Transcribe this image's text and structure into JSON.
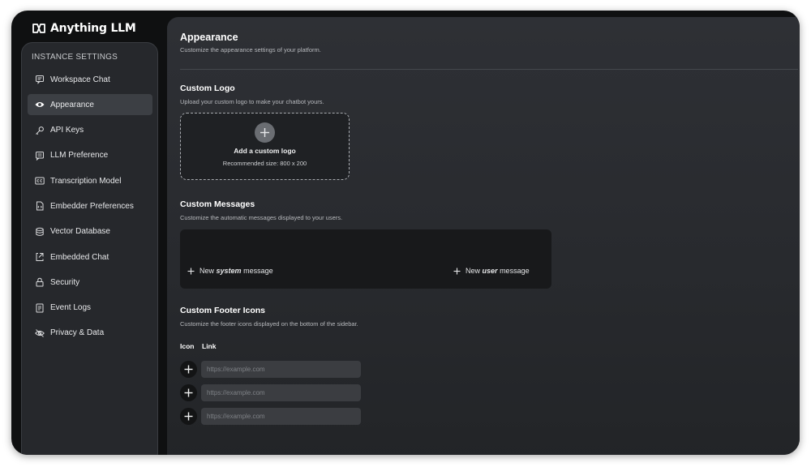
{
  "brand": {
    "name": "Anything LLM"
  },
  "sidebar": {
    "heading": "INSTANCE SETTINGS",
    "items": [
      {
        "label": "Workspace Chat",
        "icon": "chat-bubble-icon"
      },
      {
        "label": "Appearance",
        "icon": "eye-icon",
        "active": true
      },
      {
        "label": "API Keys",
        "icon": "key-icon"
      },
      {
        "label": "LLM Preference",
        "icon": "chat-text-icon"
      },
      {
        "label": "Transcription Model",
        "icon": "closed-caption-icon"
      },
      {
        "label": "Embedder Preferences",
        "icon": "file-code-icon"
      },
      {
        "label": "Vector Database",
        "icon": "database-icon"
      },
      {
        "label": "Embedded Chat",
        "icon": "code-icon"
      },
      {
        "label": "Security",
        "icon": "lock-icon"
      },
      {
        "label": "Event Logs",
        "icon": "log-file-icon"
      },
      {
        "label": "Privacy & Data",
        "icon": "eye-slash-icon"
      }
    ]
  },
  "page": {
    "title": "Appearance",
    "subtitle": "Customize the appearance settings of your platform."
  },
  "logo": {
    "title": "Custom Logo",
    "subtitle": "Upload your custom logo to make your chatbot yours.",
    "upload_label": "Add a custom logo",
    "size_hint": "Recommended size: 800 x 200"
  },
  "messages": {
    "title": "Custom Messages",
    "subtitle": "Customize the automatic messages displayed to your users.",
    "system": {
      "prefix": "New",
      "emphasis": "system",
      "suffix": "message"
    },
    "user": {
      "prefix": "New",
      "emphasis": "user",
      "suffix": "message"
    }
  },
  "footer_icons": {
    "title": "Custom Footer Icons",
    "subtitle": "Customize the footer icons displayed on the bottom of the sidebar.",
    "icon_header": "Icon",
    "link_header": "Link",
    "rows": [
      {
        "placeholder": "https://example.com"
      },
      {
        "placeholder": "https://example.com"
      },
      {
        "placeholder": "https://example.com"
      }
    ]
  },
  "colors": {
    "background": "#0f1011",
    "sidebar": "#26282c",
    "panel": "#2e3035",
    "active_item": "#3c3f44",
    "input": "#3b3d41"
  }
}
